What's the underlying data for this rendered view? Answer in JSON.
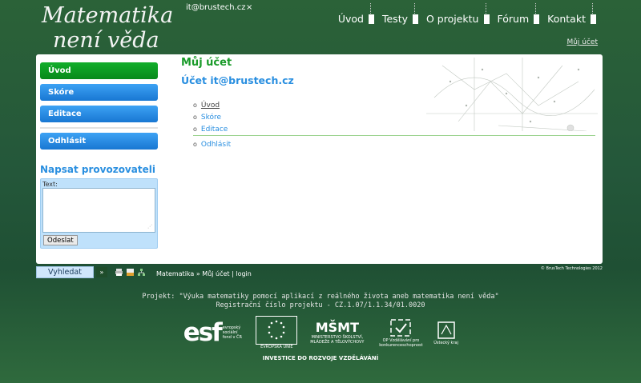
{
  "header": {
    "logo_line1": "Matematika",
    "logo_line2": "není věda",
    "user_email": "it@brustech.cz",
    "close_symbol": "×",
    "nav": [
      "Úvod",
      "Testy",
      "O projektu",
      "Fórum",
      "Kontakt"
    ],
    "account_link": "Můj účet"
  },
  "sidebar": {
    "items": [
      {
        "label": "Úvod",
        "active": true
      },
      {
        "label": "Skóre",
        "active": false
      },
      {
        "label": "Editace",
        "active": false
      }
    ],
    "logout_label": "Odhlásit",
    "contact_title": "Napsat provozovateli",
    "text_label": "Text:",
    "send_label": "Odeslat"
  },
  "main": {
    "title": "Můj účet",
    "subtitle": "Účet it@brustech.cz",
    "links": [
      "Úvod",
      "Skóre",
      "Editace"
    ],
    "logout_link": "Odhlásit"
  },
  "footer": {
    "search_label": "Vyhledat",
    "search_arrow": "»",
    "breadcrumb": {
      "root": "Matematika",
      "sep": " » ",
      "current": "Můj účet | login"
    },
    "copyright": "© BrusTech Technologies 2012",
    "project_line1": "Projekt: \"Výuka matematiky pomocí aplikací z reálného života aneb matematika není věda\"",
    "project_line2": "Registrační číslo projektu - CZ.1.07/1.1.34/01.0020",
    "logos": {
      "esf_big": "esf",
      "esf_text": "evropský sociální fond v ČR",
      "eu_text": "EVROPSKÁ UNIE",
      "msmt_big": "MŠMT",
      "msmt_text": "MINISTERSTVO ŠKOLSTVÍ, MLÁDEŽE A TĚLOVÝCHOVY",
      "op_text": "OP Vzdělávání pro konkurenceschopnost",
      "kraj_text": "Ústecký kraj"
    },
    "investice": "INVESTICE DO ROZVOJE VZDĚLÁVÁNÍ"
  },
  "colors": {
    "background": "#24573a",
    "active_menu": "#0f9e24",
    "menu": "#2a8fe0",
    "title_green": "#1a9b2a",
    "link_blue": "#2a8fe0"
  },
  "icons": [
    "close-icon",
    "print-icon",
    "pdf-icon",
    "sitemap-icon"
  ]
}
